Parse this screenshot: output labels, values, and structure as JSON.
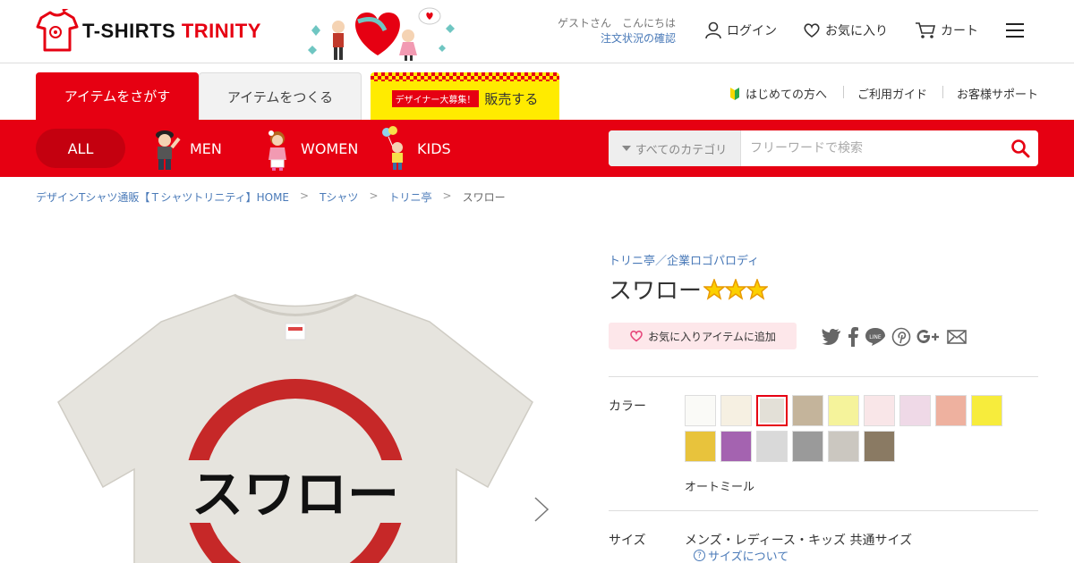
{
  "brand": {
    "name_part1": "T-SHIRTS ",
    "name_part2": "TRINITY"
  },
  "header": {
    "guest_greeting": "ゲストさん　こんにちは",
    "order_status": "注文状況の確認",
    "login": "ログイン",
    "favorites": "お気に入り",
    "cart": "カート"
  },
  "tabs": {
    "search": "アイテムをさがす",
    "make": "アイテムをつくる",
    "designer_badge": "デザイナー大募集！",
    "sell": "販売する"
  },
  "util_links": {
    "first_time": "はじめての方へ",
    "guide": "ご利用ガイド",
    "support": "お客様サポート"
  },
  "categories": {
    "all": "ALL",
    "men": "MEN",
    "women": "WOMEN",
    "kids": "KIDS"
  },
  "search": {
    "category": "すべてのカテゴリ",
    "placeholder": "フリーワードで検索"
  },
  "breadcrumb": {
    "home": "デザインTシャツ通販【Ｔシャツトリニティ】HOME",
    "tshirt": "Tシャツ",
    "shop": "トリニ亭",
    "current": "スワロー",
    "separator": ">"
  },
  "product": {
    "shop_link": "トリニ亭／企業ロゴパロディ",
    "title": "スワロー",
    "star_count": 3,
    "print_text": "スワロー",
    "favorite_add": "お気に入りアイテムに追加",
    "color_label": "カラー",
    "colors": [
      "#fafaf7",
      "#f6f0e2",
      "#e3e0d7",
      "#c4b49b",
      "#f5f39b",
      "#f9e6e8",
      "#efd9e7",
      "#eeb19f",
      "#f7ec3c",
      "#e8c33c",
      "#a463b0",
      "#d9d9d9",
      "#9a9a9a",
      "#cbc7c0",
      "#8a7a63"
    ],
    "selected_color_index": 2,
    "selected_color_name": "オートミール",
    "size_label": "サイズ",
    "size_value": "メンズ・レディース・キッズ 共通サイズ",
    "size_link": "サイズについて"
  },
  "colors": {
    "brand_red": "#e60012",
    "link_blue": "#4a7ab8",
    "sell_yellow": "#ffeb00"
  }
}
